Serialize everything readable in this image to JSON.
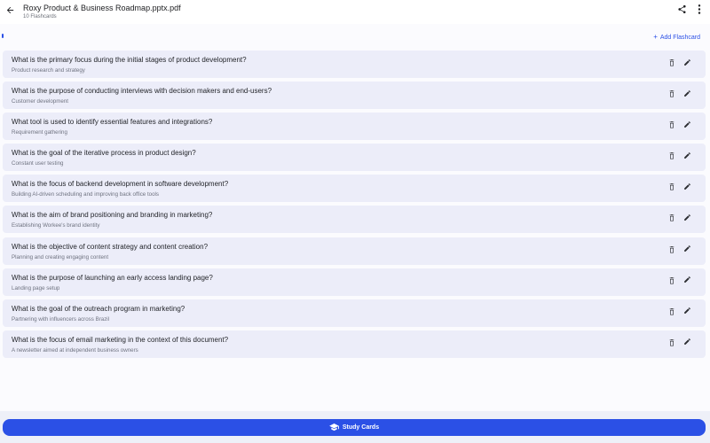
{
  "header": {
    "title": "Roxy Product & Business Roadmap.pptx.pdf",
    "subtitle": "10 Flashcards",
    "back_icon": "arrow-left-icon",
    "share_icon": "share-icon",
    "more_icon": "more-vertical-icon"
  },
  "progress": {
    "value": 0.0
  },
  "add_flashcard": {
    "label": "Add Flashcard",
    "plus": "+"
  },
  "cards": [
    {
      "question": "What is the primary focus during the initial stages of product development?",
      "answer": "Product research and strategy"
    },
    {
      "question": "What is the purpose of conducting interviews with decision makers and end-users?",
      "answer": "Customer development"
    },
    {
      "question": "What tool is used to identify essential features and integrations?",
      "answer": "Requirement gathering"
    },
    {
      "question": "What is the goal of the iterative process in product design?",
      "answer": "Constant user testing"
    },
    {
      "question": "What is the focus of backend development in software development?",
      "answer": "Building AI-driven scheduling and improving back office tools"
    },
    {
      "question": "What is the aim of brand positioning and branding in marketing?",
      "answer": "Establishing Workee's brand identity"
    },
    {
      "question": "What is the objective of content strategy and content creation?",
      "answer": "Planning and creating engaging content"
    },
    {
      "question": "What is the purpose of launching an early access landing page?",
      "answer": "Landing page setup"
    },
    {
      "question": "What is the goal of the outreach program in marketing?",
      "answer": "Partnering with influencers across Brazil"
    },
    {
      "question": "What is the focus of email marketing in the context of this document?",
      "answer": "A newsletter aimed at independent business owners"
    }
  ],
  "footer": {
    "study_label": "Study Cards",
    "study_icon": "graduation-cap-icon"
  },
  "colors": {
    "accent": "#2b50e6",
    "card_bg": "#ecedf9",
    "page_bg": "#fbfbfe"
  }
}
